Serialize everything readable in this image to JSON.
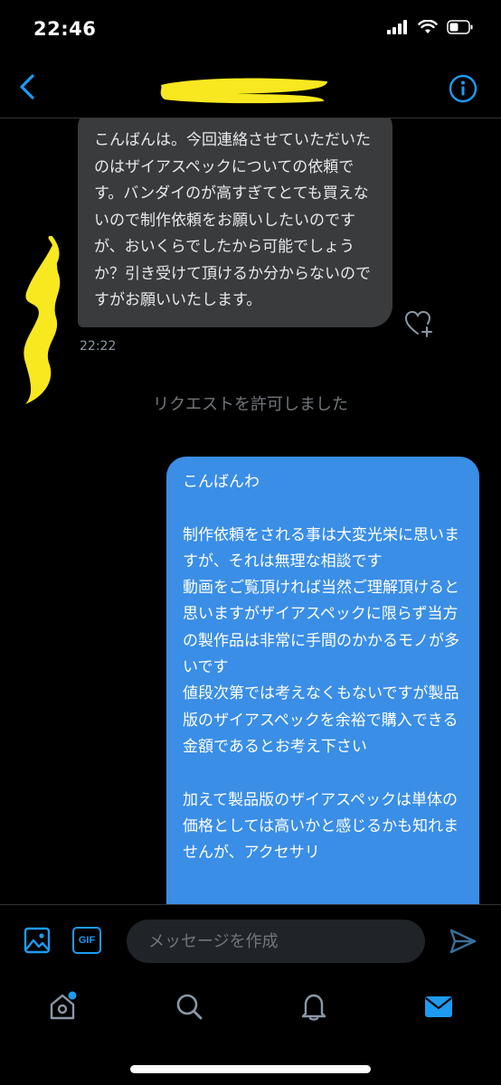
{
  "status_bar": {
    "time": "22:46"
  },
  "header": {
    "title": ""
  },
  "messages": {
    "incoming": {
      "text": "こんばんは。今回連絡させていただいたのはザイアスペックについての依頼です。バンダイのが高すぎてとても買えないので制作依頼をお願いしたいのですが、おいくらでしたから可能でしょうか？引き受けて頂けるか分からないのですがお願いいたします。",
      "time": "22:22"
    },
    "system": "リクエストを許可しました",
    "outgoing": {
      "text": "こんばんわ\n\n制作依頼をされる事は大変光栄に思いますが、それは無理な相談です\n動画をご覧頂ければ当然ご理解頂けると思いますがザイアスペックに限らず当方の製作品は非常に手間のかかるモノが多いです\n値段次第では考えなくもないですが製品版のザイアスペックを余裕で購入できる金額であるとお考え下さい\n\n加えて製品版のザイアスペックは単体の価格としては高いかと感じるかも知れませんが、アクセサリ"
    }
  },
  "composer": {
    "gif_label": "GIF",
    "placeholder": "メッセージを作成"
  },
  "colors": {
    "accent": "#1d9bf0",
    "outgoing_bubble": "#3a8ee6",
    "incoming_bubble": "#3a3b3c",
    "redaction": "#f7e81f"
  },
  "icons": {
    "back": "chevron-left-icon",
    "info": "info-icon",
    "heart_add": "heart-plus-icon",
    "image": "image-icon",
    "send": "send-icon",
    "tabs": [
      "home-icon",
      "search-icon",
      "bell-icon",
      "mail-icon"
    ]
  }
}
